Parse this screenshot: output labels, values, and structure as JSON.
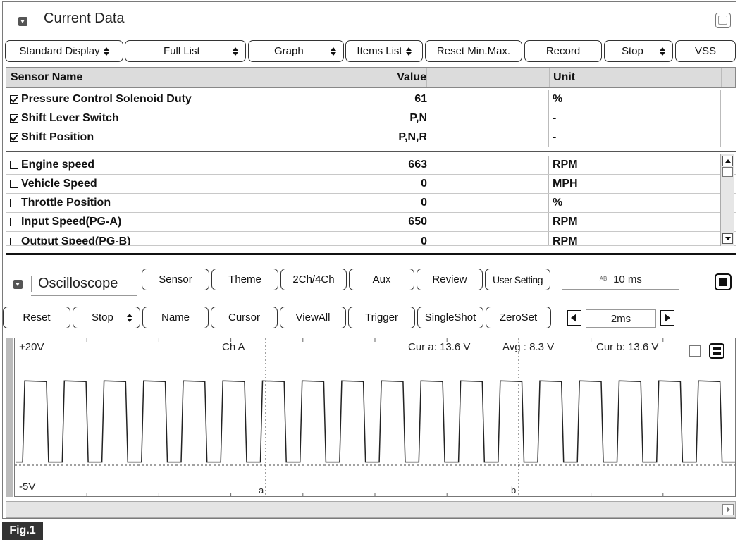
{
  "current_data": {
    "title": "Current Data",
    "toolbar": {
      "display_mode": "Standard Display",
      "list_mode": "Full List",
      "graph": "Graph",
      "items_list": "Items List",
      "reset_minmax": "Reset Min.Max.",
      "record": "Record",
      "stop": "Stop",
      "vss": "VSS"
    },
    "columns": {
      "name": "Sensor Name",
      "value": "Value",
      "unit": "Unit"
    },
    "rows": [
      {
        "name": "Pressure Control Solenoid Duty",
        "value": "61",
        "unit": "%",
        "checked": true
      },
      {
        "name": "Shift Lever Switch",
        "value": "P,N",
        "unit": "-",
        "checked": true
      },
      {
        "name": "Shift Position",
        "value": "P,N,R",
        "unit": "-",
        "checked": true
      },
      {
        "name": "Engine speed",
        "value": "663",
        "unit": "RPM",
        "checked": false
      },
      {
        "name": "Vehicle Speed",
        "value": "0",
        "unit": "MPH",
        "checked": false
      },
      {
        "name": "Throttle Position",
        "value": "0",
        "unit": "%",
        "checked": false
      },
      {
        "name": "Input Speed(PG-A)",
        "value": "650",
        "unit": "RPM",
        "checked": false
      },
      {
        "name": "Output Speed(PG-B)",
        "value": "0",
        "unit": "RPM",
        "checked": false
      }
    ]
  },
  "oscilloscope": {
    "title": "Oscilloscope",
    "toolbar1": {
      "sensor": "Sensor",
      "theme": "Theme",
      "channels": "2Ch/4Ch",
      "aux": "Aux",
      "review": "Review",
      "user_setting": "User Setting",
      "sample_icon_text": "AB",
      "sample_time": "10 ms"
    },
    "toolbar2": {
      "reset": "Reset",
      "stop": "Stop",
      "name": "Name",
      "cursor": "Cursor",
      "view_all": "ViewAll",
      "trigger": "Trigger",
      "single_shot": "SingleShot",
      "zero_set": "ZeroSet",
      "time_div": "2ms"
    },
    "display": {
      "y_max_label": "+20V",
      "y_min_label": "-5V",
      "channel": "Ch A",
      "cur_a": "Cur a: 13.6 V",
      "avg": "Avg : 8.3 V",
      "cur_b": "Cur b: 13.6 V",
      "cursor_a_label": "a",
      "cursor_b_label": "b"
    },
    "waveform": {
      "high_v": 13.6,
      "low_v": 0,
      "cycles": 18
    }
  },
  "figure_label": "Fig.1"
}
